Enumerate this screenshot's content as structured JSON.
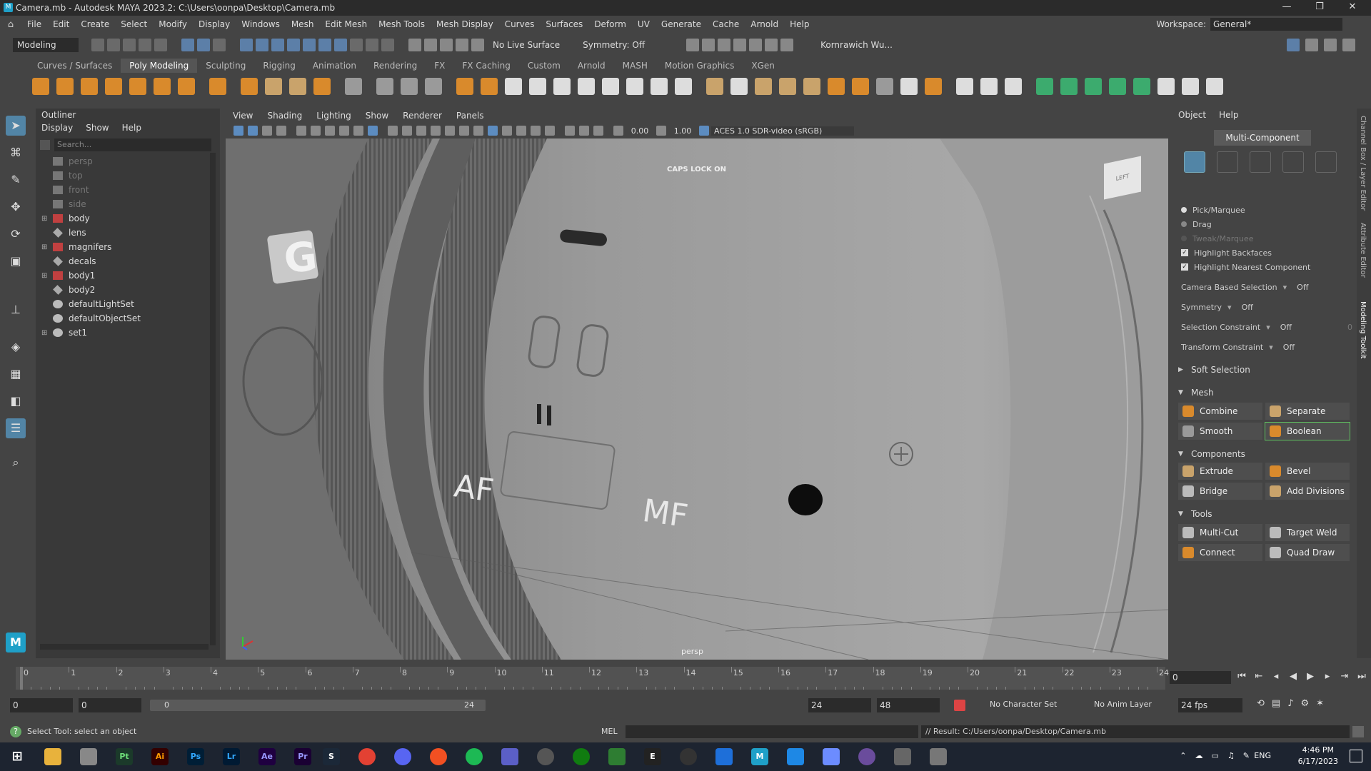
{
  "window": {
    "title": "Camera.mb - Autodesk MAYA 2023.2: C:\\Users\\oonpa\\Desktop\\Camera.mb",
    "minimize": "—",
    "maximize": "❐",
    "close": "✕"
  },
  "menubar": {
    "items": [
      "File",
      "Edit",
      "Create",
      "Select",
      "Modify",
      "Display",
      "Windows",
      "Mesh",
      "Edit Mesh",
      "Mesh Tools",
      "Mesh Display",
      "Curves",
      "Surfaces",
      "Deform",
      "UV",
      "Generate",
      "Cache",
      "Arnold",
      "Help"
    ],
    "workspace_label": "Workspace:",
    "workspace_value": "General*"
  },
  "statusline": {
    "mode": "Modeling",
    "live_surface": "No Live Surface",
    "symmetry": "Symmetry: Off",
    "user": "Kornrawich Wu..."
  },
  "shelf": {
    "tabs": [
      "Curves / Surfaces",
      "Poly Modeling",
      "Sculpting",
      "Rigging",
      "Animation",
      "Rendering",
      "FX",
      "FX Caching",
      "Custom",
      "Arnold",
      "MASH",
      "Motion Graphics",
      "XGen"
    ],
    "active_tab": "Poly Modeling"
  },
  "outliner": {
    "title": "Outliner",
    "menu": [
      "Display",
      "Show",
      "Help"
    ],
    "search_placeholder": "Search...",
    "items": [
      {
        "label": "persp",
        "type": "camera",
        "dim": true,
        "expand": ""
      },
      {
        "label": "top",
        "type": "camera",
        "dim": true,
        "expand": ""
      },
      {
        "label": "front",
        "type": "camera",
        "dim": true,
        "expand": ""
      },
      {
        "label": "side",
        "type": "camera",
        "dim": true,
        "expand": ""
      },
      {
        "label": "body",
        "type": "group",
        "dim": false,
        "expand": "+"
      },
      {
        "label": "lens",
        "type": "mesh",
        "dim": false,
        "expand": ""
      },
      {
        "label": "magnifers",
        "type": "group",
        "dim": false,
        "expand": "+"
      },
      {
        "label": "decals",
        "type": "mesh",
        "dim": false,
        "expand": ""
      },
      {
        "label": "body1",
        "type": "group",
        "dim": false,
        "expand": "+"
      },
      {
        "label": "body2",
        "type": "mesh",
        "dim": false,
        "expand": ""
      },
      {
        "label": "defaultLightSet",
        "type": "set",
        "dim": false,
        "expand": ""
      },
      {
        "label": "defaultObjectSet",
        "type": "set",
        "dim": false,
        "expand": ""
      },
      {
        "label": "set1",
        "type": "set",
        "dim": false,
        "expand": "+"
      }
    ]
  },
  "viewport": {
    "menu": [
      "View",
      "Shading",
      "Lighting",
      "Show",
      "Renderer",
      "Panels"
    ],
    "exposure": "0.00",
    "gamma": "1.00",
    "colorspace": "ACES 1.0 SDR-video (sRGB)",
    "caps_lock": "CAPS LOCK ON",
    "camera_label": "persp",
    "viewcube_label": "LEFT",
    "decal_g": "G",
    "decal_af": "AF",
    "decal_mf": "MF"
  },
  "toolkit": {
    "menu": [
      "Object",
      "Help"
    ],
    "multi_component": "Multi-Component",
    "options": {
      "pick": "Pick/Marquee",
      "drag": "Drag",
      "tweak": "Tweak/Marquee",
      "backfaces": "Highlight Backfaces",
      "nearest": "Highlight Nearest Component",
      "camera_sel": "Camera Based Selection",
      "camera_sel_val": "Off",
      "symmetry": "Symmetry",
      "symmetry_val": "Off",
      "sel_constraint": "Selection Constraint",
      "sel_constraint_val": "Off",
      "sel_constraint_num": "0",
      "trans_constraint": "Transform Constraint",
      "trans_constraint_val": "Off"
    },
    "soft_selection": "Soft Selection",
    "mesh_section": "Mesh",
    "mesh_buttons": [
      "Combine",
      "Separate",
      "Smooth",
      "Boolean"
    ],
    "components_section": "Components",
    "components_buttons": [
      "Extrude",
      "Bevel",
      "Bridge",
      "Add Divisions"
    ],
    "tools_section": "Tools",
    "tools_buttons": [
      "Multi-Cut",
      "Target Weld",
      "Connect",
      "Quad Draw"
    ]
  },
  "sidetabs": [
    "Channel Box / Layer Editor",
    "Attribute Editor",
    "Modeling Toolkit"
  ],
  "timeline": {
    "ticks": [
      "0",
      "1",
      "2",
      "3",
      "4",
      "5",
      "6",
      "7",
      "8",
      "9",
      "10",
      "11",
      "12",
      "13",
      "14",
      "15",
      "16",
      "17",
      "18",
      "19",
      "20",
      "21",
      "22",
      "23",
      "24"
    ],
    "current_frame": "0"
  },
  "range": {
    "start": "0",
    "anim_start": "0",
    "slider_start": "0",
    "slider_end": "24",
    "anim_end": "24",
    "end": "48",
    "character_set": "No Character Set",
    "anim_layer": "No Anim Layer",
    "fps": "24 fps"
  },
  "cmdline": {
    "help": "Select Tool: select an object",
    "mel": "MEL",
    "result": "// Result: C:/Users/oonpa/Desktop/Camera.mb"
  },
  "taskbar": {
    "apps": [
      "Pt",
      "Ai",
      "Ps",
      "Lr",
      "Ae",
      "Pr"
    ],
    "lang": "ENG",
    "time": "4:46 PM",
    "date": "6/17/2023"
  },
  "colors": {
    "accent": "#5285a6",
    "panel": "#444444",
    "viewport": "#8e8e8e"
  }
}
